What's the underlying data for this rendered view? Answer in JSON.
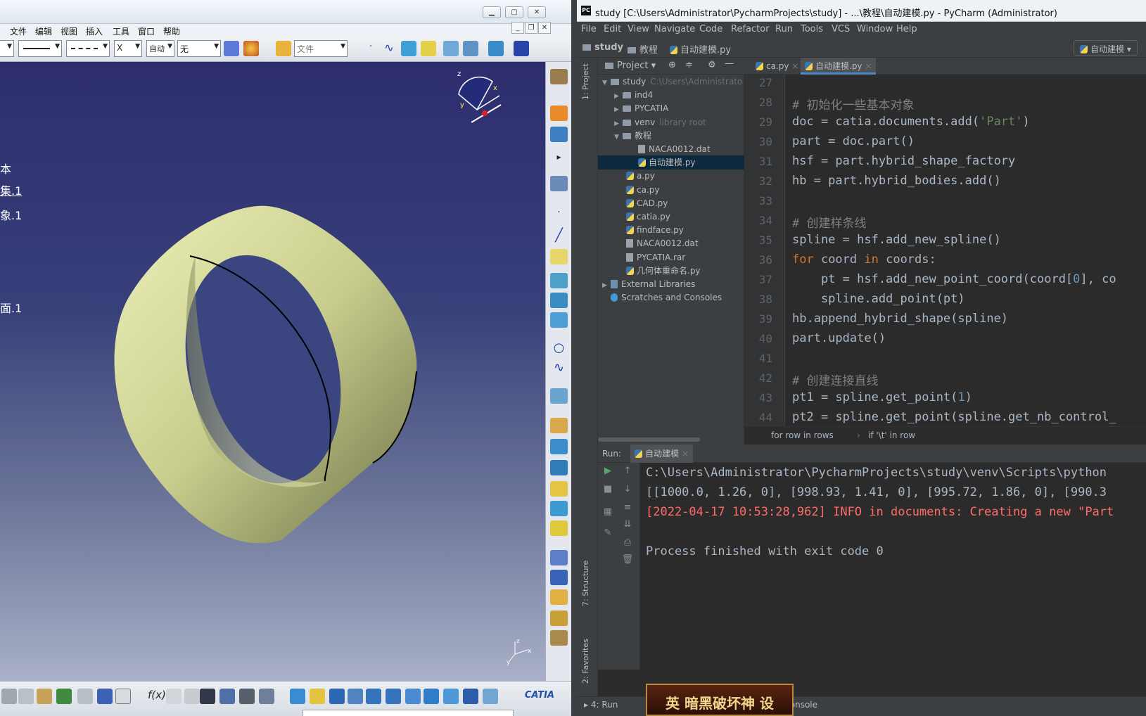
{
  "catia": {
    "menu": [
      "文件",
      "编辑",
      "视图",
      "插入",
      "工具",
      "窗口",
      "帮助"
    ],
    "toolbar": {
      "auto_combo": "自动",
      "none_combo": "无",
      "file_combo": "文件",
      "x_combo": "X"
    },
    "tree_items": [
      "本",
      "集.1",
      "象.1",
      "面.1"
    ],
    "axis_x": "x",
    "axis_y": "y",
    "axis_z": "z",
    "logo": "CATIA",
    "colors": {
      "viewport_top": "#2d2d6e",
      "ring": "#e7e9b0",
      "ring_shade": "#7d8258"
    }
  },
  "pycharm": {
    "title": "study [C:\\Users\\Administrator\\PycharmProjects\\study] - ...\\教程\\自动建模.py - PyCharm (Administrator)",
    "menu": [
      "File",
      "Edit",
      "View",
      "Navigate",
      "Code",
      "Refactor",
      "Run",
      "Tools",
      "VCS",
      "Window",
      "Help"
    ],
    "nav": {
      "root": "study",
      "folder": "教程",
      "file": "自动建模.py",
      "run_config": "自动建模"
    },
    "project_header": "Project",
    "side_labels": {
      "project": "1: Project",
      "structure": "7: Structure",
      "favorites": "2: Favorites"
    },
    "tree": [
      {
        "label": "study",
        "hint": "C:\\Users\\Administrato",
        "type": "folder",
        "indent": 0,
        "open": true
      },
      {
        "label": "ind4",
        "hint": "",
        "type": "folder",
        "indent": 1,
        "open": false
      },
      {
        "label": "PYCATIA",
        "hint": "",
        "type": "folder",
        "indent": 1,
        "open": false
      },
      {
        "label": "venv",
        "hint": "library root",
        "type": "folder",
        "indent": 1,
        "open": false
      },
      {
        "label": "教程",
        "hint": "",
        "type": "folder",
        "indent": 1,
        "open": true
      },
      {
        "label": "NACA0012.dat",
        "hint": "",
        "type": "dat",
        "indent": 3
      },
      {
        "label": "自动建模.py",
        "hint": "",
        "type": "py",
        "indent": 3,
        "selected": true
      },
      {
        "label": "a.py",
        "hint": "",
        "type": "py",
        "indent": 2
      },
      {
        "label": "ca.py",
        "hint": "",
        "type": "py",
        "indent": 2
      },
      {
        "label": "CAD.py",
        "hint": "",
        "type": "py",
        "indent": 2
      },
      {
        "label": "catia.py",
        "hint": "",
        "type": "py",
        "indent": 2
      },
      {
        "label": "findface.py",
        "hint": "",
        "type": "py",
        "indent": 2
      },
      {
        "label": "NACA0012.dat",
        "hint": "",
        "type": "dat",
        "indent": 2
      },
      {
        "label": "PYCATIA.rar",
        "hint": "",
        "type": "dat",
        "indent": 2
      },
      {
        "label": "几何体重命名.py",
        "hint": "",
        "type": "py",
        "indent": 2
      },
      {
        "label": "External Libraries",
        "hint": "",
        "type": "lib",
        "indent": 0
      },
      {
        "label": "Scratches and Consoles",
        "hint": "",
        "type": "scratch",
        "indent": 0
      }
    ],
    "tabs": [
      {
        "label": "ca.py",
        "active": false
      },
      {
        "label": "自动建模.py",
        "active": true
      }
    ],
    "line_numbers": [
      "27",
      "28",
      "29",
      "30",
      "31",
      "32",
      "33",
      "34",
      "35",
      "36",
      "37",
      "38",
      "39",
      "40",
      "41",
      "42",
      "43",
      "44"
    ],
    "code": [
      [],
      [
        {
          "t": "# 初始化一些基本对象",
          "c": "cm"
        }
      ],
      [
        {
          "t": "doc = catia.documents.add(",
          "c": ""
        },
        {
          "t": "'Part'",
          "c": "st"
        },
        {
          "t": ")",
          "c": ""
        }
      ],
      [
        {
          "t": "part = doc.part()",
          "c": ""
        }
      ],
      [
        {
          "t": "hsf = part.hybrid_shape_factory",
          "c": ""
        }
      ],
      [
        {
          "t": "hb = part.hybrid_bodies.add()",
          "c": ""
        }
      ],
      [],
      [
        {
          "t": "# 创建样条线",
          "c": "cm"
        }
      ],
      [
        {
          "t": "spline = hsf.add_new_spline()",
          "c": ""
        }
      ],
      [
        {
          "t": "for",
          "c": "kw"
        },
        {
          "t": " coord ",
          "c": ""
        },
        {
          "t": "in",
          "c": "kw"
        },
        {
          "t": " coords:",
          "c": ""
        }
      ],
      [
        {
          "t": "    pt = hsf.add_new_point_coord(coord[",
          "c": ""
        },
        {
          "t": "0",
          "c": "nu"
        },
        {
          "t": "], co",
          "c": ""
        }
      ],
      [
        {
          "t": "    spline.add_point(pt)",
          "c": ""
        }
      ],
      [
        {
          "t": "hb.append_hybrid_shape(spline)",
          "c": ""
        }
      ],
      [
        {
          "t": "part.update()",
          "c": ""
        }
      ],
      [],
      [
        {
          "t": "# 创建连接直线",
          "c": "cm"
        }
      ],
      [
        {
          "t": "pt1 = spline.get_point(",
          "c": ""
        },
        {
          "t": "1",
          "c": "nu"
        },
        {
          "t": ")",
          "c": ""
        }
      ],
      [
        {
          "t": "pt2 = spline.get_point(spline.get_nb_control_",
          "c": ""
        }
      ]
    ],
    "breadcrumb": [
      "for row in rows",
      "if '\\t' in row"
    ],
    "run": {
      "label": "Run:",
      "tab": "自动建模",
      "lines": [
        {
          "t": "C:\\Users\\Administrator\\PycharmProjects\\study\\venv\\Scripts\\python",
          "c": "#a9b7c6"
        },
        {
          "t": "[[1000.0, 1.26, 0], [998.93, 1.41, 0], [995.72, 1.86, 0], [990.3",
          "c": "#a9b7c6"
        },
        {
          "t": "[2022-04-17 10:53:28,962] INFO in documents: Creating a new \"Part",
          "c": "#ff6b68"
        },
        {
          "t": "",
          "c": "#a9b7c6"
        },
        {
          "t": "Process finished with exit code 0",
          "c": "#a9b7c6"
        }
      ]
    },
    "status_run": "4: Run",
    "status_console": "hon Console",
    "banner": "英 暗黑破坏神 设"
  }
}
